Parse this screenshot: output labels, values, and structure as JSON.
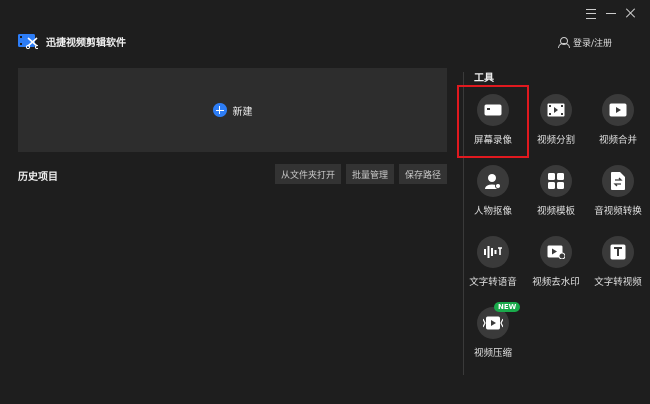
{
  "app": {
    "title": "迅捷视频剪辑软件"
  },
  "header": {
    "login_label": "登录/注册"
  },
  "new_project": {
    "label": "新建"
  },
  "history": {
    "title": "历史项目",
    "buttons": [
      "从文件夹打开",
      "批量管理",
      "保存路径"
    ]
  },
  "tools": {
    "title": "工具",
    "items": [
      {
        "label": "屏幕录像",
        "icon": "screen-record-icon"
      },
      {
        "label": "视频分割",
        "icon": "film-split-icon"
      },
      {
        "label": "视频合并",
        "icon": "video-merge-icon"
      },
      {
        "label": "人物抠像",
        "icon": "portrait-cutout-icon"
      },
      {
        "label": "视频模板",
        "icon": "template-icon"
      },
      {
        "label": "音视频转换",
        "icon": "convert-icon"
      },
      {
        "label": "文字转语音",
        "icon": "text-to-speech-icon"
      },
      {
        "label": "视频去水印",
        "icon": "remove-watermark-icon"
      },
      {
        "label": "文字转视频",
        "icon": "text-to-video-icon"
      },
      {
        "label": "视频压缩",
        "icon": "video-compress-icon",
        "badge": "NEW"
      }
    ]
  },
  "colors": {
    "background": "#1e1e1e",
    "card": "#2d2d2d",
    "accent": "#2d7df6",
    "highlight": "#e0191f",
    "badge": "#1aaa4b"
  }
}
